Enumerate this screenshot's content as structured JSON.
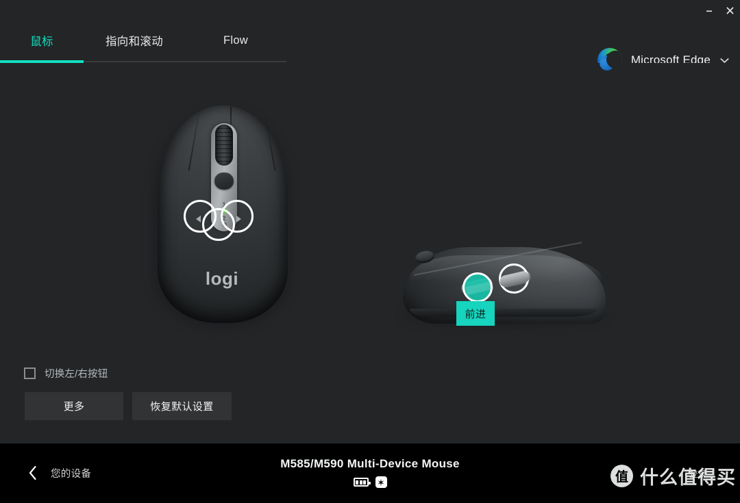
{
  "window": {
    "minimize_label": "–",
    "close_label": "×"
  },
  "tabs": [
    {
      "label": "鼠标",
      "active": true
    },
    {
      "label": "指向和滚动",
      "active": false
    },
    {
      "label": "Flow",
      "active": false
    }
  ],
  "app_selector": {
    "app_name": "Microsoft Edge",
    "logo_icon": "edge-logo-icon",
    "chevron_icon": "chevron-down-icon"
  },
  "mouse_top_view": {
    "brand_text": "logi",
    "channel_one": "1",
    "channel_two": "2",
    "highlights": [
      {
        "name": "wheel-tilt-left",
        "arrow": "left-arrow-icon"
      },
      {
        "name": "scroll-wheel",
        "arrow": ""
      },
      {
        "name": "wheel-tilt-right",
        "arrow": "right-arrow-icon"
      }
    ]
  },
  "mouse_side_view": {
    "tooltip_label": "前进",
    "tooltip_color": "#16d4bd",
    "highlights": [
      {
        "name": "side-button-forward",
        "selected": true
      },
      {
        "name": "side-button-back",
        "selected": false
      }
    ]
  },
  "controls": {
    "swap_buttons_label": "切换左/右按钮",
    "swap_buttons_checked": false,
    "more_label": "更多",
    "reset_label": "恢复默认设置"
  },
  "footer": {
    "back_label": "您的设备",
    "back_icon": "chevron-left-icon",
    "device_name": "M585/M590 Multi-Device Mouse",
    "battery_icon": "battery-icon",
    "unifying_icon": "unifying-receiver-icon",
    "signin_label": "登录"
  },
  "watermark": {
    "logo_char": "值",
    "text": "什么值得买"
  },
  "theme": {
    "accent": "#12e0c2",
    "bg": "#232527",
    "footer_bg": "#000000",
    "button_bg": "#313335"
  }
}
